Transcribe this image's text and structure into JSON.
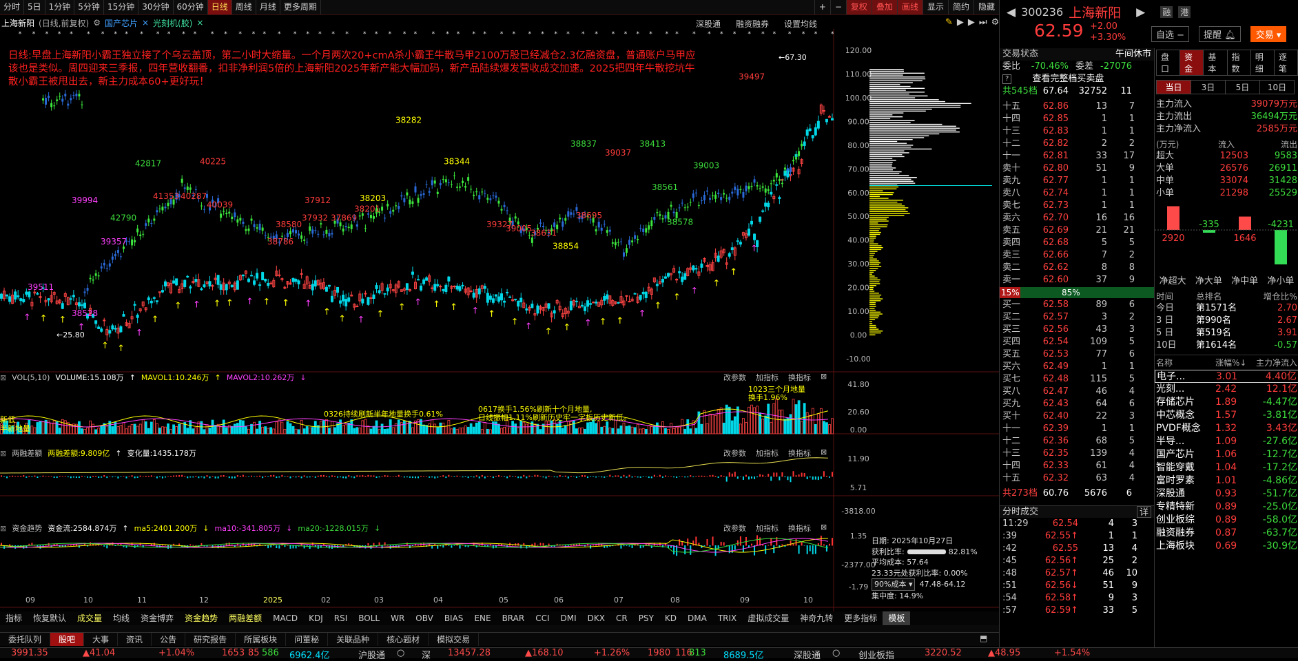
{
  "toolbar": {
    "periods": [
      "分时",
      "5日",
      "1分钟",
      "5分钟",
      "15分钟",
      "30分钟",
      "60分钟",
      "日线",
      "周线",
      "月线",
      "更多周期"
    ],
    "active_period": "日线",
    "right": [
      "+",
      "−",
      "复权",
      "叠加",
      "画线",
      "显示",
      "简约",
      "隐藏"
    ],
    "red_right": [
      "复权",
      "叠加"
    ],
    "dark_red": "画线"
  },
  "chart_header": {
    "stock": "上海新阳",
    "mode": "(日线,前复权)",
    "tag1": "国产芯片",
    "tag2": "光刻机(胶)",
    "links": [
      "深股通",
      "融资融券",
      "设置均线"
    ]
  },
  "annotation": "日线:早盘上海新阳小霸王独立接了个乌云盖顶，第二小时大缩量。一个月两次20+cmA杀小霸王牛散马甲2100万股已经减仓2.3亿融资盘，普通账户马甲应该也是类似。周四迎来三季报，四年营收翻番，扣非净利润5倍的上海新阳2025年新产能大幅加码，新产品陆续爆发营收成交加速。2025把四年牛散挖坑牛散小霸王被甩出去，新主力成本60+更好玩！",
  "price_axis": [
    "120.00",
    "110.00",
    "100.00",
    "90.00",
    "80.00",
    "70.00",
    "60.00",
    "50.00",
    "40.00",
    "30.00",
    "20.00",
    "10.00",
    "0.00",
    "-10.00"
  ],
  "chip_labels": {
    "high": "67.30",
    "low": "25.80"
  },
  "yellow_nums": [
    "38837",
    "39037",
    "38413",
    "38561",
    "38578",
    "39003",
    "39497",
    "38282",
    "38344",
    "38203",
    "37912",
    "37932",
    "37869",
    "38201",
    "38786",
    "38580",
    "41353",
    "40287",
    "40225",
    "40039",
    "39357",
    "39994",
    "42790",
    "42817",
    "39511",
    "38528",
    "38695",
    "38854",
    "38631",
    "39005",
    "39327"
  ],
  "volume": {
    "title": "VOL(5,10)",
    "vol": "VOLUME:15.108万",
    "m1": "MAVOL1:10.246万",
    "m2": "MAVOL2:10.262万",
    "btns": [
      "改参数",
      "加指标",
      "换指标"
    ],
    "axis": [
      "41.80",
      "20.60",
      "0.00"
    ],
    "note1": "0326持续刷新半年地量换手0.61%",
    "note2a": "0617换手1.56%刷新十个月地量,",
    "note2b": "日线振幅1.11%刷新历史牢一字板历史新低。",
    "note3a": "1023三个月地量",
    "note3b": "换手1.96%",
    "left1": "新低",
    "left2": "半新地量"
  },
  "margin": {
    "title": "两融差额",
    "v1": "两融差额:9.809亿",
    "v2": "变化量:1435.178万",
    "btns": [
      "改参数",
      "加指标",
      "换指标"
    ],
    "axis": [
      "11.90",
      "5.71",
      "-3818.00"
    ]
  },
  "fund": {
    "title": "资金趋势",
    "v1": "资金流:2584.874万",
    "v2": "ma5:2401.200万",
    "v3": "ma10:-341.805万",
    "v4": "ma20:-1228.015万",
    "btns": [
      "改参数",
      "加指标",
      "换指标"
    ],
    "axis": [
      "1.35",
      "-2377.00",
      "-1.79"
    ]
  },
  "chip_info": {
    "date": "日期: 2025年10月27日",
    "profit": "获利比率:",
    "profit_val": "82.81%",
    "avg": "平均成本: 57.64",
    "cost_line": "23.33元处获利比率: 0.00%",
    "sel": "90%成本",
    "range": "47.48-64.12",
    "conc": "集中度: 14.9%"
  },
  "time_axis": [
    "09",
    "10",
    "11",
    "12",
    "2025",
    "02",
    "03",
    "04",
    "05",
    "06",
    "07",
    "08",
    "09",
    "10"
  ],
  "ind_tabs": [
    "指标",
    "恢复默认",
    "成交量",
    "均线",
    "资金博弈",
    "资金趋势",
    "两融差额",
    "MACD",
    "KDJ",
    "RSI",
    "BOLL",
    "WR",
    "OBV",
    "BIAS",
    "ENE",
    "BRAR",
    "CCI",
    "DMI",
    "DKX",
    "CR",
    "PSY",
    "KD",
    "DMA",
    "TRIX",
    "虚拟成交量",
    "神奇九转",
    "更多指标",
    "模板"
  ],
  "ind_yellow": [
    "成交量",
    "资金趋势",
    "两融差额"
  ],
  "bottom_tabs": [
    "委托队列",
    "股吧",
    "大事",
    "资讯",
    "公告",
    "研究报告",
    "所属板块",
    "问董秘",
    "关联品种",
    "核心题材",
    "模拟交易"
  ],
  "stock": {
    "code": "300236",
    "name": "上海新阳",
    "price": "62.59",
    "chg": "+2.00",
    "pct": "+3.30%",
    "badges": [
      "融",
      "港"
    ],
    "btns": [
      "自选 −",
      "提醒",
      "交易"
    ]
  },
  "trade": {
    "status_label": "交易状态",
    "status": "午间休市",
    "wb_label": "委比",
    "wb": "-70.46%",
    "wc_label": "委差",
    "wc": "-27076",
    "full": "查看完整档买卖盘",
    "total_sell": "共545档",
    "ts_p": "67.64",
    "ts_v": "32752",
    "ts_c": "11",
    "total_buy": "共273档",
    "tb_p": "60.76",
    "tb_v": "5676",
    "tb_c": "6",
    "ratio_l": "15%",
    "ratio_r": "85%"
  },
  "asks": [
    [
      "十五",
      "62.86",
      "13",
      "7"
    ],
    [
      "十四",
      "62.85",
      "1",
      "1"
    ],
    [
      "十三",
      "62.83",
      "1",
      "1"
    ],
    [
      "十二",
      "62.82",
      "2",
      "2"
    ],
    [
      "十一",
      "62.81",
      "33",
      "17"
    ],
    [
      "卖十",
      "62.80",
      "51",
      "9"
    ],
    [
      "卖九",
      "62.77",
      "1",
      "1"
    ],
    [
      "卖八",
      "62.74",
      "1",
      "1"
    ],
    [
      "卖七",
      "62.73",
      "1",
      "1"
    ],
    [
      "卖六",
      "62.70",
      "16",
      "16"
    ],
    [
      "卖五",
      "62.69",
      "21",
      "21"
    ],
    [
      "卖四",
      "62.68",
      "5",
      "5"
    ],
    [
      "卖三",
      "62.66",
      "7",
      "2"
    ],
    [
      "卖二",
      "62.62",
      "8",
      "8"
    ],
    [
      "卖一",
      "62.60",
      "37",
      "9"
    ]
  ],
  "bids": [
    [
      "买一",
      "62.58",
      "89",
      "6"
    ],
    [
      "买二",
      "62.57",
      "3",
      "2"
    ],
    [
      "买三",
      "62.56",
      "43",
      "3"
    ],
    [
      "买四",
      "62.54",
      "109",
      "5"
    ],
    [
      "买五",
      "62.53",
      "77",
      "6"
    ],
    [
      "买六",
      "62.49",
      "1",
      "1"
    ],
    [
      "买七",
      "62.48",
      "115",
      "5"
    ],
    [
      "买八",
      "62.47",
      "46",
      "4"
    ],
    [
      "买九",
      "62.43",
      "64",
      "6"
    ],
    [
      "买十",
      "62.40",
      "22",
      "3"
    ],
    [
      "十一",
      "62.39",
      "1",
      "1"
    ],
    [
      "十二",
      "62.36",
      "68",
      "5"
    ],
    [
      "十三",
      "62.35",
      "139",
      "4"
    ],
    [
      "十四",
      "62.33",
      "61",
      "4"
    ],
    [
      "十五",
      "62.32",
      "63",
      "4"
    ]
  ],
  "fs": {
    "title": "分时成交",
    "detail": "详",
    "rows": [
      [
        "11:29",
        "62.54",
        "4",
        "3"
      ],
      [
        ":39",
        "62.55↑",
        "1",
        "1"
      ],
      [
        ":42",
        "62.55",
        "13",
        "4"
      ],
      [
        ":45",
        "62.56↑",
        "25",
        "2"
      ],
      [
        ":48",
        "62.57↑",
        "46",
        "10"
      ],
      [
        ":51",
        "62.56↓",
        "51",
        "9"
      ],
      [
        ":54",
        "62.58↑",
        "9",
        "3"
      ],
      [
        ":57",
        "62.59↑",
        "33",
        "5"
      ]
    ]
  },
  "capital": {
    "tabs": [
      "盘口",
      "资金",
      "基本",
      "指数",
      "明细",
      "逐笔"
    ],
    "active": "资金",
    "periods": [
      "当日",
      "3日",
      "5日",
      "10日"
    ],
    "inflow_l": "主力流入",
    "inflow": "39079万元",
    "outflow_l": "主力流出",
    "outflow": "36494万元",
    "net_l": "主力净流入",
    "net": "2585万元",
    "unit": "(万元)",
    "in_h": "流入",
    "out_h": "流出",
    "rows": [
      [
        "超大",
        "12503",
        "9583"
      ],
      [
        "大单",
        "26576",
        "26911"
      ],
      [
        "中单",
        "33074",
        "31428"
      ],
      [
        "小单",
        "21298",
        "25529"
      ]
    ],
    "bars": [
      {
        "label": "净超大",
        "v": 2920
      },
      {
        "label": "净大单",
        "v": -335
      },
      {
        "label": "净中单",
        "v": 1646
      },
      {
        "label": "净小单",
        "v": -4231
      }
    ]
  },
  "rank": {
    "h": [
      "时间",
      "总排名",
      "增仓比%"
    ],
    "rows": [
      [
        "今日",
        "第1571名",
        "2.70"
      ],
      [
        "3 日",
        "第990名",
        "2.67"
      ],
      [
        "5 日",
        "第519名",
        "3.91"
      ],
      [
        "10日",
        "第1614名",
        "-0.57"
      ]
    ]
  },
  "sectors": {
    "h": [
      "名称",
      "涨幅%↓",
      "主力净流入"
    ],
    "rows": [
      [
        "电子...",
        "3.01",
        "4.40亿"
      ],
      [
        "光刻...",
        "2.42",
        "12.1亿"
      ],
      [
        "存储芯片",
        "1.89",
        "-4.47亿"
      ],
      [
        "中芯概念",
        "1.57",
        "-3.81亿"
      ],
      [
        "PVDF概念",
        "1.32",
        "3.43亿"
      ],
      [
        "半导...",
        "1.09",
        "-27.6亿"
      ],
      [
        "国产芯片",
        "1.06",
        "-12.7亿"
      ],
      [
        "智能穿戴",
        "1.04",
        "-17.2亿"
      ],
      [
        "富时罗素",
        "1.01",
        "-4.86亿"
      ],
      [
        "深股通",
        "0.93",
        "-51.7亿"
      ],
      [
        "专精特新",
        "0.89",
        "-25.0亿"
      ],
      [
        "创业板综",
        "0.89",
        "-58.0亿"
      ],
      [
        "融资融券",
        "0.87",
        "-63.7亿"
      ],
      [
        "上海板块",
        "0.69",
        "-30.9亿"
      ]
    ]
  },
  "status_bar": {
    "items": [
      "3991.35",
      "▲41.04",
      "+1.04%",
      "1653",
      "85",
      "586",
      "6962.4亿",
      "沪股通",
      "○",
      "深",
      "13457.28",
      "▲168.10",
      "+1.26%",
      "1980",
      "116",
      "813",
      "8689.5亿",
      "深股通",
      "○",
      "创业板指",
      "3220.52",
      "▲48.95",
      "+1.54%"
    ]
  },
  "colors": {
    "up": "#ff3c3c",
    "down": "#00e0e0",
    "green": "#3cdc3c",
    "yellow": "#ffff00",
    "blue": "#2a6ad8",
    "magenta": "#ff40ff"
  }
}
